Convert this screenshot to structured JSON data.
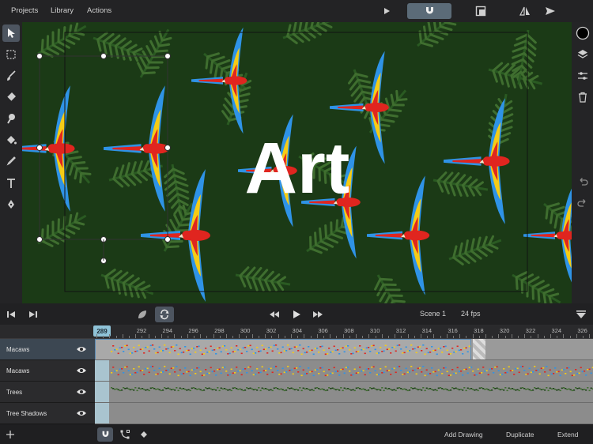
{
  "menu": {
    "projects": "Projects",
    "library": "Library",
    "actions": "Actions"
  },
  "canvas_text": "Art",
  "transport": {
    "scene": "Scene 1",
    "fps": "24 fps"
  },
  "timeline": {
    "current_frame": "289",
    "frame_labels": [
      "292",
      "294",
      "296",
      "298",
      "300",
      "302",
      "304",
      "306",
      "308",
      "310",
      "312",
      "314",
      "316",
      "318",
      "320",
      "322",
      "324",
      "326"
    ],
    "layers": [
      {
        "name": "Macaws",
        "selected": true
      },
      {
        "name": "Macaws",
        "selected": false
      },
      {
        "name": "Trees",
        "selected": false
      },
      {
        "name": "Tree Shadows",
        "selected": false
      }
    ]
  },
  "bottom": {
    "add_drawing": "Add Drawing",
    "duplicate": "Duplicate",
    "extend": "Extend"
  },
  "colors": {
    "accent": "#5b6b78",
    "playhead": "#8fc3d8",
    "leaf_dark": "#1f4419",
    "leaf_light": "#3f6e2f",
    "macaw_red": "#e0251f",
    "macaw_blue": "#2f93e6",
    "macaw_yellow": "#f5cc16"
  },
  "icons": {
    "left_tools": [
      "select-arrow-icon",
      "marquee-icon",
      "brush-icon",
      "eraser-icon",
      "smudge-icon",
      "fill-bucket-icon",
      "eyedropper-icon",
      "text-icon",
      "pen-icon"
    ],
    "right_tools": [
      "color-swatch-icon",
      "layers-icon",
      "adjust-icon",
      "trash-icon",
      "undo-icon",
      "redo-icon"
    ]
  }
}
